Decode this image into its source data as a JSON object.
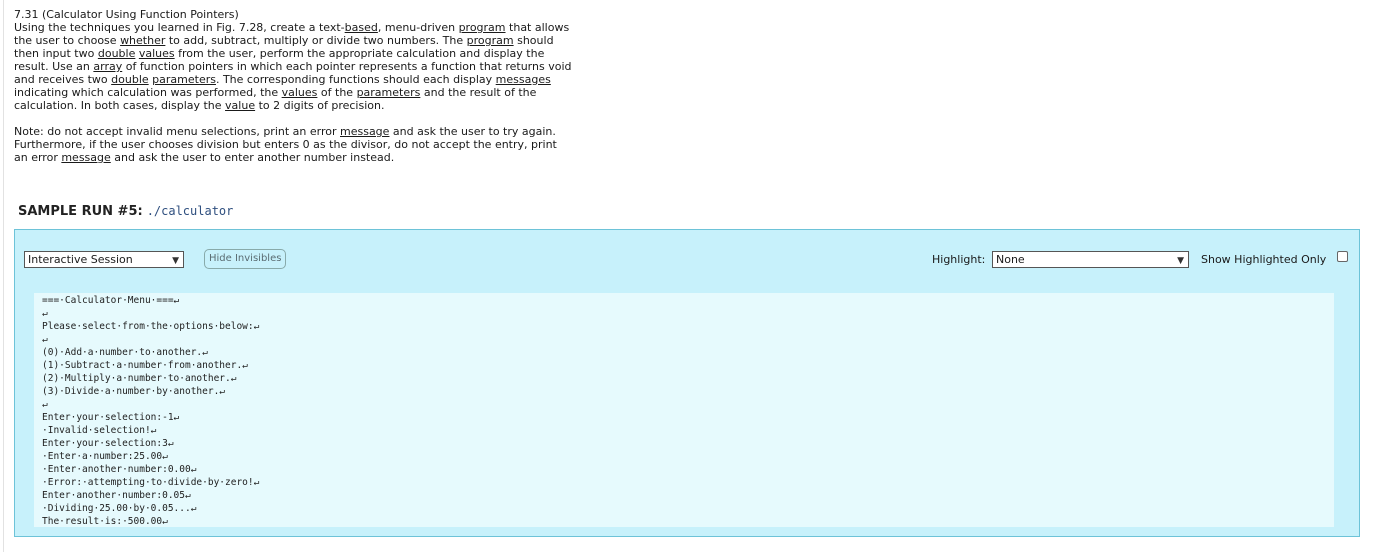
{
  "problem": {
    "title": "7.31 (Calculator Using Function Pointers)",
    "paragraph1_segments": [
      {
        "text": "Using the techniques you learned in Fig. 7.28, create a text-",
        "u": false
      },
      {
        "text": "based",
        "u": true
      },
      {
        "text": ", menu-driven ",
        "u": false
      },
      {
        "text": "program",
        "u": true
      },
      {
        "text": " that allows the user to choose ",
        "u": false
      },
      {
        "text": "whether",
        "u": true
      },
      {
        "text": " to add, subtract, multiply or divide two numbers. The ",
        "u": false
      },
      {
        "text": "program",
        "u": true
      },
      {
        "text": " should then input two ",
        "u": false
      },
      {
        "text": "double",
        "u": true
      },
      {
        "text": " ",
        "u": false
      },
      {
        "text": "values",
        "u": true
      },
      {
        "text": " from the user, perform the appropriate calculation and display the result. Use an ",
        "u": false
      },
      {
        "text": "array",
        "u": true
      },
      {
        "text": " of function pointers in which each pointer represents a function that returns void and receives two ",
        "u": false
      },
      {
        "text": "double",
        "u": true
      },
      {
        "text": " ",
        "u": false
      },
      {
        "text": "parameters",
        "u": true
      },
      {
        "text": ". The corresponding functions should each display ",
        "u": false
      },
      {
        "text": "messages",
        "u": true
      },
      {
        "text": " indicating which calculation was performed, the ",
        "u": false
      },
      {
        "text": "values",
        "u": true
      },
      {
        "text": " of the ",
        "u": false
      },
      {
        "text": "parameters",
        "u": true
      },
      {
        "text": " and the result of the calculation. In both cases, display the ",
        "u": false
      },
      {
        "text": "value",
        "u": true
      },
      {
        "text": " to 2 digits of precision.",
        "u": false
      }
    ],
    "paragraph2_segments": [
      {
        "text": "Note: do not accept invalid menu selections, print an error ",
        "u": false
      },
      {
        "text": "message",
        "u": true
      },
      {
        "text": " and ask the user to try again. Furthermore, if the user chooses division but enters 0 as the divisor, do not accept the entry, print an error ",
        "u": false
      },
      {
        "text": "message",
        "u": true
      },
      {
        "text": " and ask the user to enter another number instead.",
        "u": false
      }
    ]
  },
  "sample_run": {
    "label": "SAMPLE RUN #5:",
    "command": "./calculator"
  },
  "toolbar": {
    "session_select_value": "Interactive Session",
    "hide_invisibles_label": "Hide Invisibles",
    "highlight_label": "Highlight:",
    "highlight_select_value": "None",
    "show_highlighted_only_label": "Show Highlighted Only",
    "show_highlighted_only_checked": false
  },
  "output_lines": [
    "===·Calculator·Menu·===↵",
    "↵",
    "Please·select·from·the·options·below:↵",
    "↵",
    "(0)·Add·a·number·to·another.↵",
    "(1)·Subtract·a·number·from·another.↵",
    "(2)·Multiply·a·number·to·another.↵",
    "(3)·Divide·a·number·by·another.↵",
    "↵",
    "Enter·your·selection:-1↵",
    "·Invalid·selection!↵",
    "Enter·your·selection:3↵",
    "·Enter·a·number:25.00↵",
    "·Enter·another·number:0.00↵",
    "·Error:·attempting·to·divide·by·zero!↵",
    "Enter·another·number:0.05↵",
    "·Dividing·25.00·by·0.05...↵",
    "The·result·is:·500.00↵"
  ],
  "icons": {
    "dropdown": "chevron-down-icon",
    "checkbox": "checkbox-icon"
  },
  "colors": {
    "panel_bg": "#c7f1fb",
    "output_bg": "#e6fafd",
    "panel_border": "#6dc3d8"
  }
}
